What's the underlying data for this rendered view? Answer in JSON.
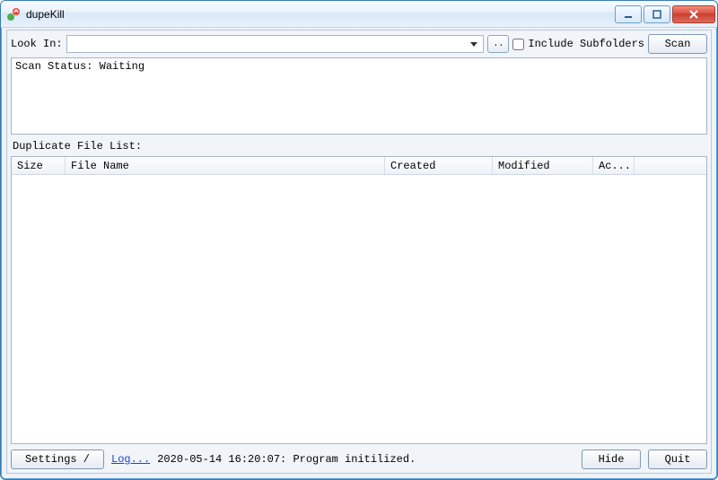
{
  "window": {
    "title": "dupeKill"
  },
  "toolbar": {
    "lookin_label": "Look In:",
    "lookin_value": "",
    "browse_label": "..",
    "include_subfolders": "Include Subfolders",
    "include_checked": false,
    "scan_label": "Scan"
  },
  "status": {
    "text": "Scan Status: Waiting"
  },
  "list": {
    "group_label": "Duplicate File List:",
    "columns": {
      "size": "Size",
      "file_name": "File Name",
      "created": "Created",
      "modified": "Modified",
      "action": "Ac..."
    },
    "rows": []
  },
  "footer": {
    "settings_label": "Settings /",
    "log_link": "Log...",
    "log_message": "2020-05-14 16:20:07: Program initilized.",
    "hide_label": "Hide",
    "quit_label": "Quit"
  },
  "icons": {
    "app": "dupekill-app-icon",
    "dropdown": "chevron-down-icon",
    "min": "minimize-icon",
    "max": "maximize-icon",
    "close": "close-icon"
  }
}
